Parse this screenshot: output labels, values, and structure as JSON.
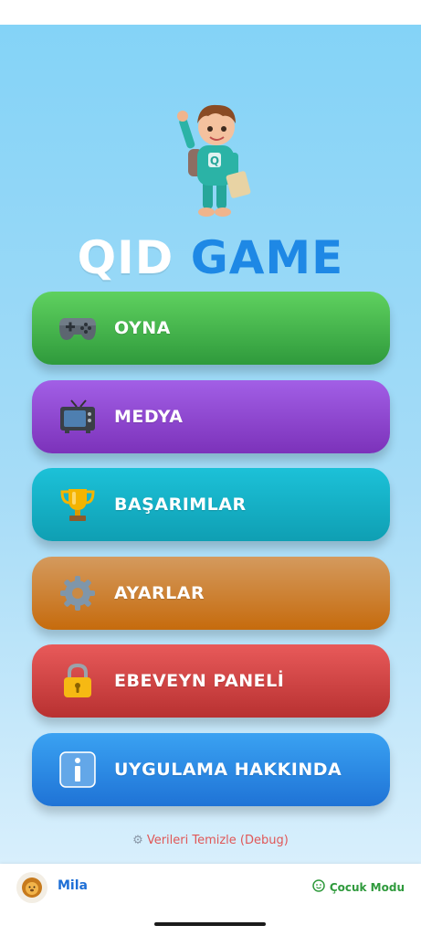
{
  "app": {
    "logo_word_1": "QID",
    "logo_word_2": "GAME"
  },
  "menu": [
    {
      "id": "play",
      "label": "OYNA",
      "icon": "game-controller-icon",
      "color": "#3fae46"
    },
    {
      "id": "media",
      "label": "MEDYA",
      "icon": "television-icon",
      "color": "#8e44d1"
    },
    {
      "id": "achievements",
      "label": "BAŞARIMLAR",
      "icon": "trophy-icon",
      "color": "#12b0c7"
    },
    {
      "id": "settings",
      "label": "AYARLAR",
      "icon": "gear-icon",
      "color": "#cc7f33"
    },
    {
      "id": "parent-panel",
      "label": "EBEVEYN PANELİ",
      "icon": "lock-icon",
      "color": "#d24545"
    },
    {
      "id": "about",
      "label": "UYGULAMA HAKKINDA",
      "icon": "info-icon",
      "color": "#2b8ae6"
    }
  ],
  "debug": {
    "label": "Verileri Temizle (Debug)",
    "icon": "gear-icon"
  },
  "bottom_bar": {
    "user_name": "Mila",
    "avatar_icon": "lion-icon",
    "mode_label": "Çocuk Modu",
    "mode_icon": "smile-icon"
  }
}
